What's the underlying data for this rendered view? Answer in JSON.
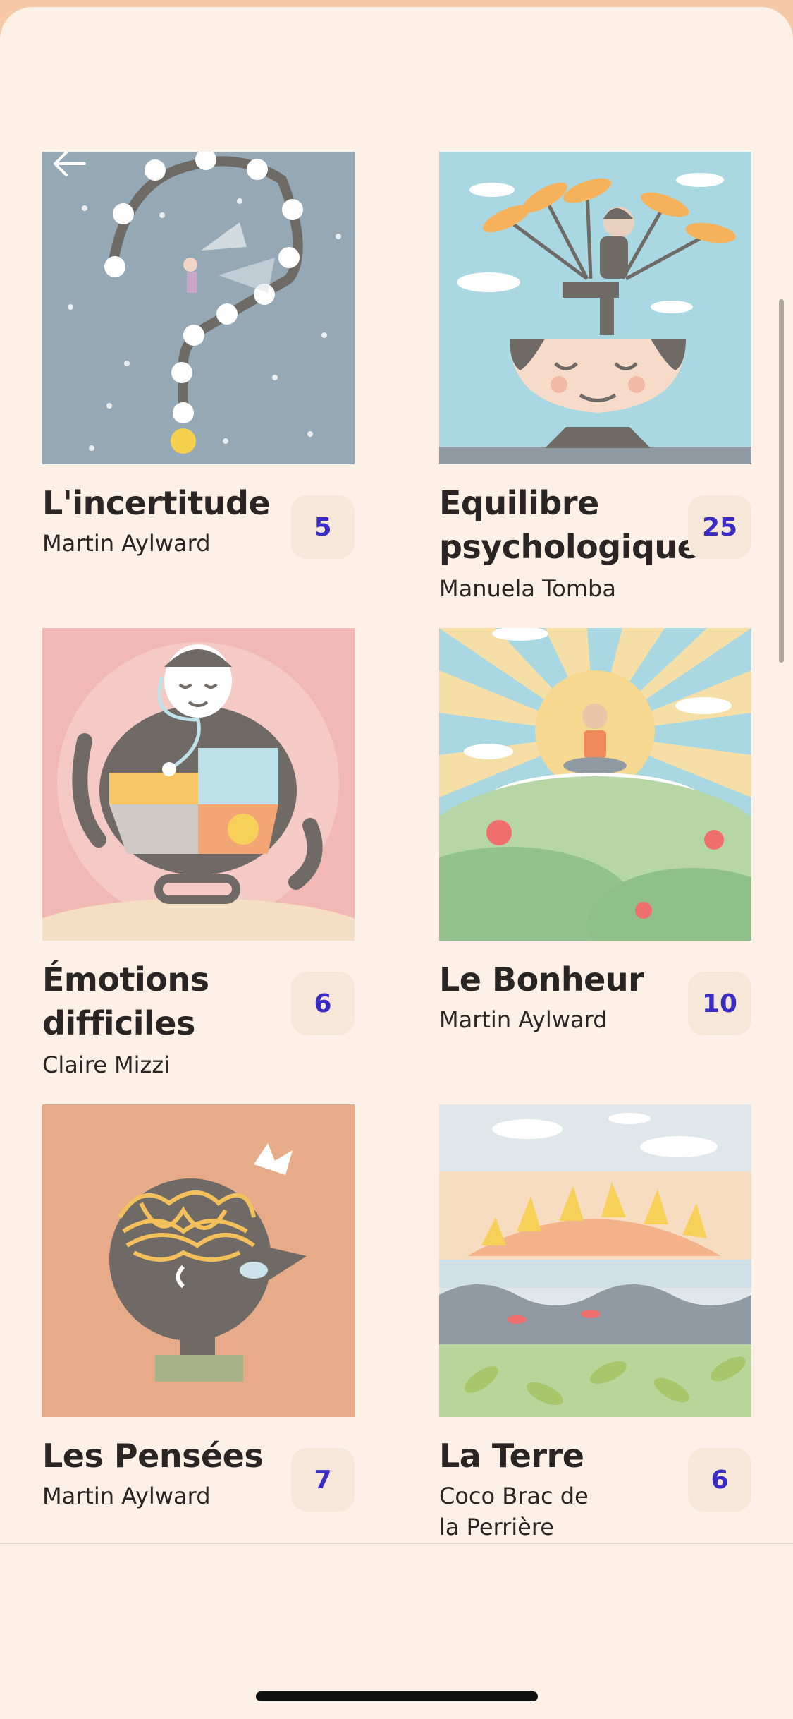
{
  "navigation": {
    "back_icon": "arrow-left-icon"
  },
  "collections": [
    {
      "title": "L'incertitude",
      "author": "Martin Aylward",
      "count": "5",
      "art": "question-mark-path",
      "bg": "#95a8b5"
    },
    {
      "title": "Equilibre psychologique",
      "author": "Manuela Tomba",
      "count": "25",
      "art": "balance-figure",
      "bg": "#a9d8e3"
    },
    {
      "title": "Émotions difficiles",
      "author": "Claire Mizzi",
      "count": "6",
      "art": "stethoscope-emotions",
      "bg": "#f2b8b4"
    },
    {
      "title": "Le Bonheur",
      "author": "Martin Aylward",
      "count": "10",
      "art": "sun-meditation",
      "bg": "#f5dfa7"
    },
    {
      "title": "Les Pensées",
      "author": "Martin Aylward",
      "count": "7",
      "art": "tangled-thoughts",
      "bg": "#e8ab8a"
    },
    {
      "title": "La Terre",
      "author": "Coco Brac de la Perrière",
      "count": "6",
      "art": "earth-landscape",
      "bg": "#dfe7ea"
    }
  ],
  "colors": {
    "background": "#fdf1e7",
    "accent": "#3a2bc6",
    "badge": "#f7e7d8"
  }
}
